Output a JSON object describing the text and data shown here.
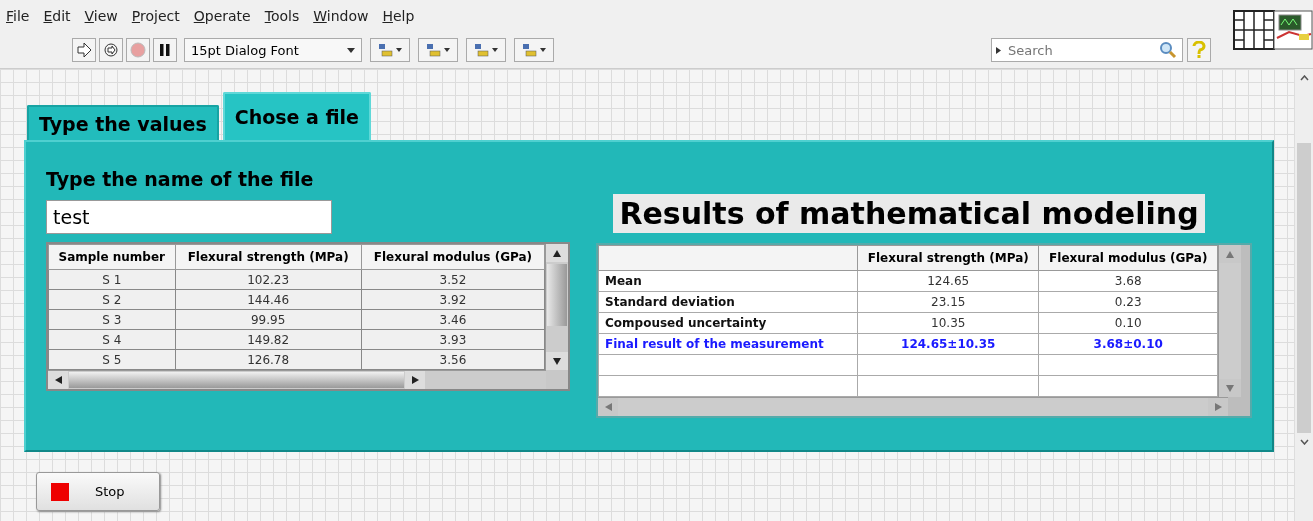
{
  "menu": [
    "File",
    "Edit",
    "View",
    "Project",
    "Operate",
    "Tools",
    "Window",
    "Help"
  ],
  "toolbar": {
    "font": "15pt Dialog Font",
    "search": {
      "placeholder": "Search"
    }
  },
  "tabs": [
    {
      "label": "Type the values",
      "selected": false
    },
    {
      "label": "Chose a file",
      "selected": true
    }
  ],
  "file_label": "Type the name of the file",
  "file_name": "test",
  "samples": {
    "columns": [
      "Sample number",
      "Flexural strength (MPa)",
      "Flexural modulus (GPa)"
    ],
    "rows": [
      [
        "S 1",
        "102.23",
        "3.52"
      ],
      [
        "S 2",
        "144.46",
        "3.92"
      ],
      [
        "S 3",
        "99.95",
        "3.46"
      ],
      [
        "S 4",
        "149.82",
        "3.93"
      ],
      [
        "S 5",
        "126.78",
        "3.56"
      ]
    ]
  },
  "results_title": "Results of mathematical modeling",
  "results": {
    "columns": [
      "Flexural strength (MPa)",
      "Flexural modulus (GPa)"
    ],
    "rows": [
      {
        "kind": "plain",
        "label": "Mean",
        "values": [
          "124.65",
          "3.68"
        ]
      },
      {
        "kind": "plain",
        "label": "Standard deviation",
        "values": [
          "23.15",
          "0.23"
        ]
      },
      {
        "kind": "plain",
        "label": "Compoused  uncertainty",
        "values": [
          "10.35",
          "0.10"
        ]
      },
      {
        "kind": "final",
        "label": "Final result of the measurement",
        "values": [
          "124.65±10.35",
          "3.68±0.10"
        ]
      }
    ]
  },
  "stop_button": "Stop"
}
